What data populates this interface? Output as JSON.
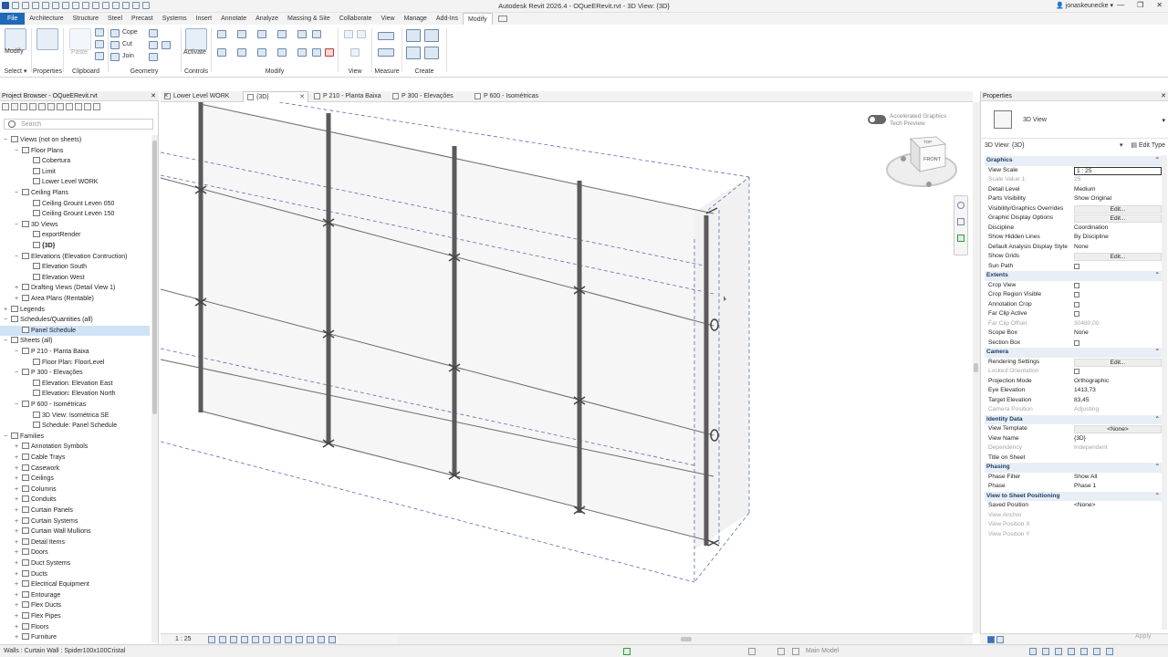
{
  "window": {
    "title": "Autodesk Revit 2026.4 - OQueERevit.rvt - 3D View: {3D}",
    "user": "jonaskeunecke"
  },
  "ribbon_tabs": [
    "File",
    "Architecture",
    "Structure",
    "Steel",
    "Precast",
    "Systems",
    "Insert",
    "Annotate",
    "Analyze",
    "Massing & Site",
    "Collaborate",
    "View",
    "Manage",
    "Add-Ins",
    "Modify"
  ],
  "ribbon": {
    "select": {
      "button": "Modify",
      "group": "Select"
    },
    "properties": {
      "group": "Properties"
    },
    "clipboard": {
      "paste": "Paste",
      "group": "Clipboard"
    },
    "geometry": {
      "cope": "Cope",
      "cut": "Cut",
      "join": "Join",
      "group": "Geometry"
    },
    "controls": {
      "button": "Activate",
      "group": "Controls"
    },
    "modify": {
      "group": "Modify"
    },
    "view": {
      "group": "View"
    },
    "measure": {
      "group": "Measure"
    },
    "create": {
      "group": "Create"
    }
  },
  "project_browser": {
    "title": "Project Browser - OQueERevit.rvt",
    "search_placeholder": "Search",
    "items": [
      {
        "label": "Views (not on sheets)",
        "level": 0,
        "exp": "−"
      },
      {
        "label": "Floor Plans",
        "level": 1,
        "exp": "−"
      },
      {
        "label": "Cobertura",
        "level": 2,
        "exp": ""
      },
      {
        "label": "Limit",
        "level": 2,
        "exp": ""
      },
      {
        "label": "Lower Level WORK",
        "level": 2,
        "exp": ""
      },
      {
        "label": "Ceiling Plans",
        "level": 1,
        "exp": "−"
      },
      {
        "label": "Ceiling Grount Leven 050",
        "level": 2,
        "exp": ""
      },
      {
        "label": "Ceiling Grount Leven 150",
        "level": 2,
        "exp": ""
      },
      {
        "label": "3D Views",
        "level": 1,
        "exp": "−"
      },
      {
        "label": "exportRender",
        "level": 2,
        "exp": ""
      },
      {
        "label": "{3D}",
        "level": 2,
        "exp": "",
        "bold": true
      },
      {
        "label": "Elevations (Elevation Contruction)",
        "level": 1,
        "exp": "−"
      },
      {
        "label": "Elevation South",
        "level": 2,
        "exp": ""
      },
      {
        "label": "Elevation West",
        "level": 2,
        "exp": ""
      },
      {
        "label": "Drafting Views (Detail View 1)",
        "level": 1,
        "exp": "+"
      },
      {
        "label": "Area Plans (Rentable)",
        "level": 1,
        "exp": "+"
      },
      {
        "label": "Legends",
        "level": 0,
        "exp": "+"
      },
      {
        "label": "Schedules/Quantities (all)",
        "level": 0,
        "exp": "−"
      },
      {
        "label": "Panel Schedule",
        "level": 1,
        "exp": "",
        "selected": true
      },
      {
        "label": "Sheets (all)",
        "level": 0,
        "exp": "−"
      },
      {
        "label": "P 210 - Planta Baixa",
        "level": 1,
        "exp": "−"
      },
      {
        "label": "Floor Plan: FloorLevel",
        "level": 2,
        "exp": ""
      },
      {
        "label": "P 300 - Elevações",
        "level": 1,
        "exp": "−"
      },
      {
        "label": "Elevation: Elevation East",
        "level": 2,
        "exp": ""
      },
      {
        "label": "Elevation: Elevation North",
        "level": 2,
        "exp": ""
      },
      {
        "label": "P 600 - Isométricas",
        "level": 1,
        "exp": "−"
      },
      {
        "label": "3D View: Isométrica SE",
        "level": 2,
        "exp": ""
      },
      {
        "label": "Schedule: Panel Schedule",
        "level": 2,
        "exp": ""
      },
      {
        "label": "Families",
        "level": 0,
        "exp": "−"
      },
      {
        "label": "Annotation Symbols",
        "level": 1,
        "exp": "+"
      },
      {
        "label": "Cable Trays",
        "level": 1,
        "exp": "+"
      },
      {
        "label": "Casework",
        "level": 1,
        "exp": "+"
      },
      {
        "label": "Ceilings",
        "level": 1,
        "exp": "+"
      },
      {
        "label": "Columns",
        "level": 1,
        "exp": "+"
      },
      {
        "label": "Conduits",
        "level": 1,
        "exp": "+"
      },
      {
        "label": "Curtain Panels",
        "level": 1,
        "exp": "+"
      },
      {
        "label": "Curtain Systems",
        "level": 1,
        "exp": "+"
      },
      {
        "label": "Curtain Wall Mullions",
        "level": 1,
        "exp": "+"
      },
      {
        "label": "Detail Items",
        "level": 1,
        "exp": "+"
      },
      {
        "label": "Doors",
        "level": 1,
        "exp": "+"
      },
      {
        "label": "Duct Systems",
        "level": 1,
        "exp": "+"
      },
      {
        "label": "Ducts",
        "level": 1,
        "exp": "+"
      },
      {
        "label": "Electrical Equipment",
        "level": 1,
        "exp": "+"
      },
      {
        "label": "Entourage",
        "level": 1,
        "exp": "+"
      },
      {
        "label": "Flex Ducts",
        "level": 1,
        "exp": "+"
      },
      {
        "label": "Flex Pipes",
        "level": 1,
        "exp": "+"
      },
      {
        "label": "Floors",
        "level": 1,
        "exp": "+"
      },
      {
        "label": "Furniture",
        "level": 1,
        "exp": "+"
      }
    ]
  },
  "view_tabs": [
    {
      "label": "Lower Level WORK"
    },
    {
      "label": "{3D}",
      "active": true
    },
    {
      "label": "P 210 - Planta Baixa"
    },
    {
      "label": "P 300 - Elevações"
    },
    {
      "label": "P 600 - Isométricas"
    }
  ],
  "viewport": {
    "accel_line1": "Accelerated Graphics",
    "accel_line2": "Tech Preview",
    "viewcube_top": "TOP",
    "viewcube_front": "FRONT"
  },
  "view_control_bar": {
    "scale": "1 : 25"
  },
  "status_bar": {
    "selection": "Walls : Curtain Wall : Spider100x100Cristal",
    "model": "Main Model"
  },
  "properties": {
    "title": "Properties",
    "type_name": "3D View",
    "instance_selector": "3D View: {3D}",
    "edit_type": "Edit Type",
    "apply": "Apply",
    "rows": [
      {
        "section": "Graphics"
      },
      {
        "k": "View Scale",
        "v": "1 : 25",
        "input": true
      },
      {
        "k": "Scale Value    1:",
        "v": "25",
        "grey": true
      },
      {
        "k": "Detail Level",
        "v": "Medium"
      },
      {
        "k": "Parts Visibility",
        "v": "Show Original"
      },
      {
        "k": "Visibility/Graphics Overrides",
        "v": "Edit...",
        "btn": true
      },
      {
        "k": "Graphic Display Options",
        "v": "Edit...",
        "btn": true
      },
      {
        "k": "Discipline",
        "v": "Coordination"
      },
      {
        "k": "Show Hidden Lines",
        "v": "By Discipline"
      },
      {
        "k": "Default Analysis Display Style",
        "v": "None"
      },
      {
        "k": "Show Grids",
        "v": "Edit...",
        "btn": true
      },
      {
        "k": "Sun Path",
        "cb": true
      },
      {
        "section": "Extents"
      },
      {
        "k": "Crop View",
        "cb": true
      },
      {
        "k": "Crop Region Visible",
        "cb": true
      },
      {
        "k": "Annotation Crop",
        "cb": true
      },
      {
        "k": "Far Clip Active",
        "cb": true
      },
      {
        "k": "Far Clip Offset",
        "v": "30480,00",
        "grey": true
      },
      {
        "k": "Scope Box",
        "v": "None"
      },
      {
        "k": "Section Box",
        "cb": true
      },
      {
        "section": "Camera"
      },
      {
        "k": "Rendering Settings",
        "v": "Edit...",
        "btn": true
      },
      {
        "k": "Locked Orientation",
        "cb": true,
        "grey": true
      },
      {
        "k": "Projection Mode",
        "v": "Orthographic"
      },
      {
        "k": "Eye Elevation",
        "v": "1413,73"
      },
      {
        "k": "Target Elevation",
        "v": "83,45"
      },
      {
        "k": "Camera Position",
        "v": "Adjusting",
        "grey": true
      },
      {
        "section": "Identity Data"
      },
      {
        "k": "View Template",
        "v": "<None>",
        "btn": true
      },
      {
        "k": "View Name",
        "v": "{3D}"
      },
      {
        "k": "Dependency",
        "v": "Independent",
        "grey": true
      },
      {
        "k": "Title on Sheet",
        "v": ""
      },
      {
        "section": "Phasing"
      },
      {
        "k": "Phase Filter",
        "v": "Show All"
      },
      {
        "k": "Phase",
        "v": "Phase 1"
      },
      {
        "section": "View to Sheet Positioning"
      },
      {
        "k": "Saved Position",
        "v": "<None>"
      },
      {
        "k": "View Anchor",
        "v": "",
        "grey": true
      },
      {
        "k": "View Position X",
        "v": "",
        "grey": true
      },
      {
        "k": "View Position Y",
        "v": "",
        "grey": true
      }
    ]
  },
  "colors": {
    "file_tab": "#1f6ab8",
    "section_bg": "#e8eef5",
    "mullion": "#5a5a5a",
    "dash": "#5a6fb0"
  }
}
